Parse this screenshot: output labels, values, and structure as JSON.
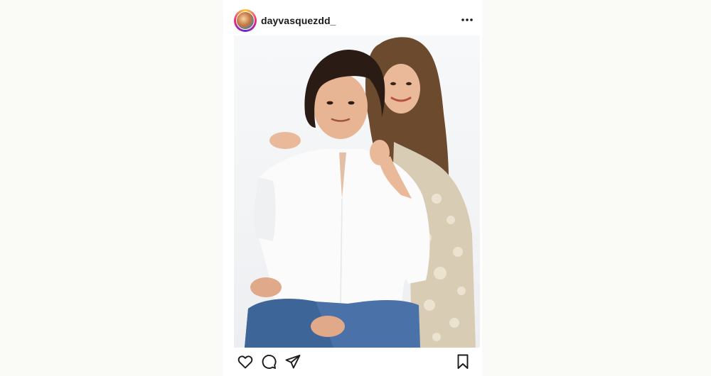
{
  "post": {
    "username": "dayvasquezdd_",
    "avatar_icon": "profile-photo-avatar",
    "more_icon": "more-dots-icon",
    "photo_icon": "couple-portrait-photo"
  },
  "actions": {
    "like_icon": "heart-icon",
    "comment_icon": "comment-bubble-icon",
    "share_icon": "send-arrow-icon",
    "save_icon": "bookmark-icon"
  },
  "colors": {
    "text": "#1a1a1a",
    "background": "#ffffff",
    "page": "#fafaf7"
  }
}
